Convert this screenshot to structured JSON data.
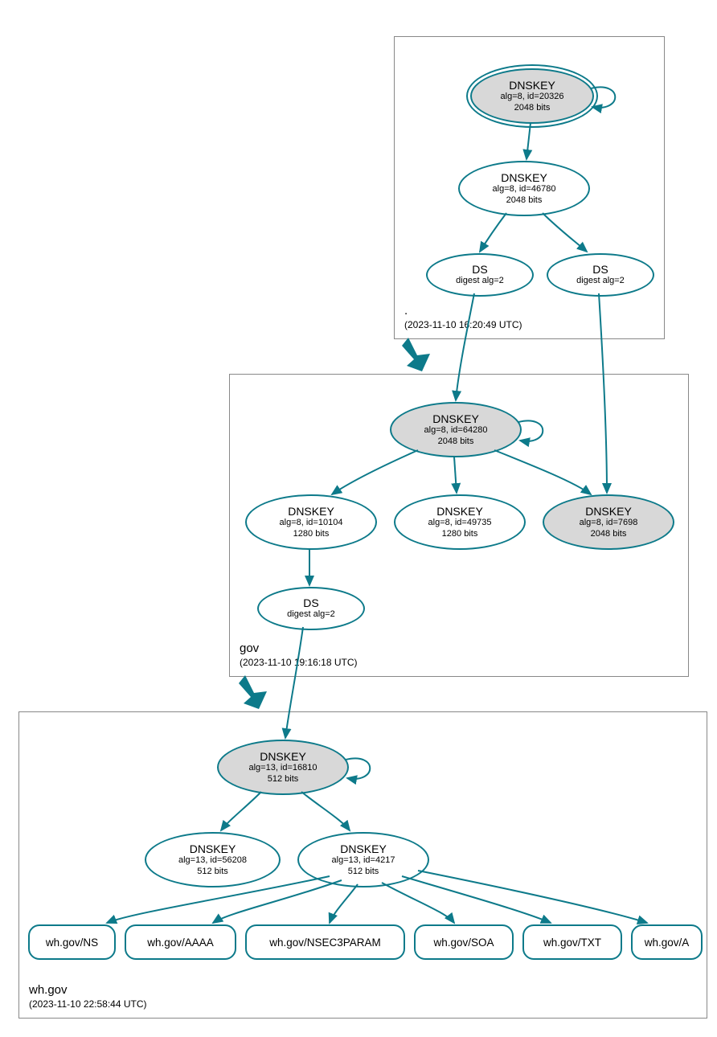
{
  "zones": {
    "root": {
      "name": ".",
      "date": "(2023-11-10 16:20:49 UTC)",
      "nodes": {
        "ksk": {
          "title": "DNSKEY",
          "sub1": "alg=8, id=20326",
          "sub2": "2048 bits"
        },
        "zsk": {
          "title": "DNSKEY",
          "sub1": "alg=8, id=46780",
          "sub2": "2048 bits"
        },
        "ds1": {
          "title": "DS",
          "sub1": "digest alg=2"
        },
        "ds2": {
          "title": "DS",
          "sub1": "digest alg=2"
        }
      }
    },
    "gov": {
      "name": "gov",
      "date": "(2023-11-10 19:16:18 UTC)",
      "nodes": {
        "ksk": {
          "title": "DNSKEY",
          "sub1": "alg=8, id=64280",
          "sub2": "2048 bits"
        },
        "k1": {
          "title": "DNSKEY",
          "sub1": "alg=8, id=10104",
          "sub2": "1280 bits"
        },
        "k2": {
          "title": "DNSKEY",
          "sub1": "alg=8, id=49735",
          "sub2": "1280 bits"
        },
        "k3": {
          "title": "DNSKEY",
          "sub1": "alg=8, id=7698",
          "sub2": "2048 bits"
        },
        "ds": {
          "title": "DS",
          "sub1": "digest alg=2"
        }
      }
    },
    "whgov": {
      "name": "wh.gov",
      "date": "(2023-11-10 22:58:44 UTC)",
      "nodes": {
        "ksk": {
          "title": "DNSKEY",
          "sub1": "alg=13, id=16810",
          "sub2": "512 bits"
        },
        "k1": {
          "title": "DNSKEY",
          "sub1": "alg=13, id=56208",
          "sub2": "512 bits"
        },
        "k2": {
          "title": "DNSKEY",
          "sub1": "alg=13, id=4217",
          "sub2": "512 bits"
        }
      },
      "records": {
        "ns": "wh.gov/NS",
        "aaaa": "wh.gov/AAAA",
        "nsec3param": "wh.gov/NSEC3PARAM",
        "soa": "wh.gov/SOA",
        "txt": "wh.gov/TXT",
        "a": "wh.gov/A"
      }
    }
  }
}
